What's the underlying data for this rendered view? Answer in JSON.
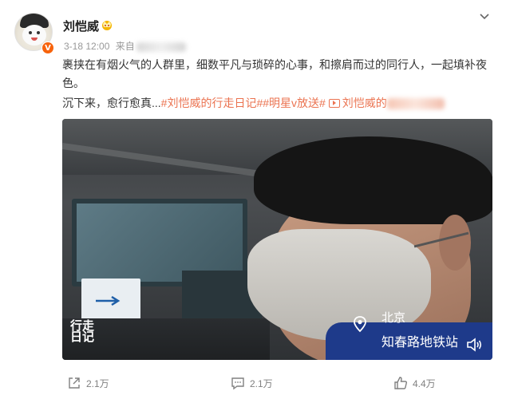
{
  "post": {
    "username": "刘恺威",
    "avatar_badge": "V",
    "time": "3-18 12:00",
    "source_prefix": "来自",
    "text_line1": "裹挟在有烟火气的人群里，细数平凡与琐碎的心事，和擦肩而过的同行人，一起填补夜色。",
    "text_line2_prefix": "沉下来，愈行愈真...",
    "tag1": "#刘恺威的行走日记#",
    "tag2": "#明星v放送#",
    "video_link_text": "刘恺威的",
    "icons": {
      "crown": "crown-icon",
      "chevron": "chevron-down-icon",
      "video": "video-icon"
    }
  },
  "video": {
    "location_city": "北京",
    "location_place": "知春路地铁站",
    "logo_text": "行走日记",
    "icons": {
      "pin": "location-pin-icon",
      "volume": "volume-icon"
    }
  },
  "actions": {
    "share_count": "2.1万",
    "comment_count": "2.1万",
    "like_count": "4.4万"
  },
  "colors": {
    "tag": "#eb7350",
    "badge": "#f7630c",
    "meta": "#999999"
  }
}
